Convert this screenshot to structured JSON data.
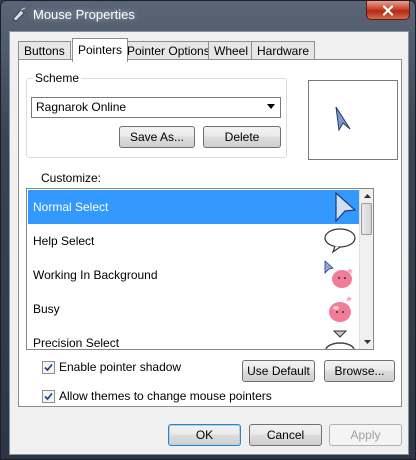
{
  "window": {
    "title": "Mouse Properties"
  },
  "tabs": [
    {
      "label": "Buttons",
      "active": false
    },
    {
      "label": "Pointers",
      "active": true
    },
    {
      "label": "Pointer Options",
      "active": false
    },
    {
      "label": "Wheel",
      "active": false
    },
    {
      "label": "Hardware",
      "active": false
    }
  ],
  "scheme": {
    "legend": "Scheme",
    "selected": "Ragnarok Online",
    "save_as_label": "Save As...",
    "delete_label": "Delete"
  },
  "customize": {
    "label": "Customize:",
    "items": [
      {
        "label": "Normal Select",
        "icon": "arrow-cursor-icon",
        "selected": true
      },
      {
        "label": "Help Select",
        "icon": "speech-bubble-cursor-icon",
        "selected": false
      },
      {
        "label": "Working In Background",
        "icon": "poring-busy-arrow-icon",
        "selected": false
      },
      {
        "label": "Busy",
        "icon": "poring-busy-icon",
        "selected": false
      },
      {
        "label": "Precision Select",
        "icon": "precision-cursor-icon",
        "selected": false
      }
    ]
  },
  "options": {
    "pointer_shadow_label": "Enable pointer shadow",
    "pointer_shadow_checked": true,
    "allow_themes_label": "Allow themes to change mouse pointers",
    "allow_themes_checked": true,
    "use_default_label": "Use Default",
    "browse_label": "Browse..."
  },
  "footer": {
    "ok_label": "OK",
    "cancel_label": "Cancel",
    "apply_label": "Apply",
    "apply_enabled": false
  },
  "colors": {
    "selection": "#3399ff",
    "cursor_fill": "#6f8fcf",
    "poring_pink": "#f06a8a"
  }
}
